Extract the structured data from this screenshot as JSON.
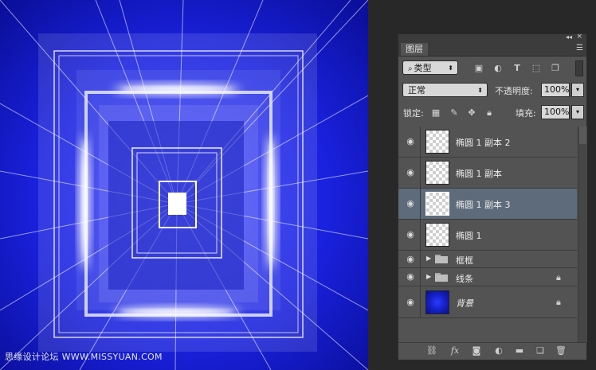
{
  "watermark": "思缘设计论坛 WWW.MISSYUAN.COM",
  "panel": {
    "tab_title": "图层",
    "filter_kind": "类型",
    "blend_mode": "正常",
    "opacity_label": "不透明度:",
    "opacity_value": "100%",
    "lock_label": "锁定:",
    "fill_label": "填充:",
    "fill_value": "100%",
    "layers": [
      {
        "name": "椭圆 1 副本 2",
        "type": "shape",
        "selected": false,
        "locked": false
      },
      {
        "name": "椭圆 1 副本",
        "type": "shape",
        "selected": false,
        "locked": false
      },
      {
        "name": "椭圆 1 副本 3",
        "type": "shape",
        "selected": true,
        "locked": false
      },
      {
        "name": "椭圆 1",
        "type": "shape",
        "selected": false,
        "locked": false
      },
      {
        "name": "框框",
        "type": "group",
        "selected": false,
        "locked": false
      },
      {
        "name": "线条",
        "type": "group",
        "selected": false,
        "locked": true
      },
      {
        "name": "背景",
        "type": "background",
        "selected": false,
        "locked": true
      }
    ],
    "bottom_icons": [
      "link-icon",
      "fx-icon",
      "mask-icon",
      "adjustment-icon",
      "folder-icon",
      "new-layer-icon",
      "trash-icon"
    ],
    "colors": {
      "panel": "#535353",
      "selected": "#5e6b7a",
      "canvas_blue": "#1a22e0"
    }
  }
}
